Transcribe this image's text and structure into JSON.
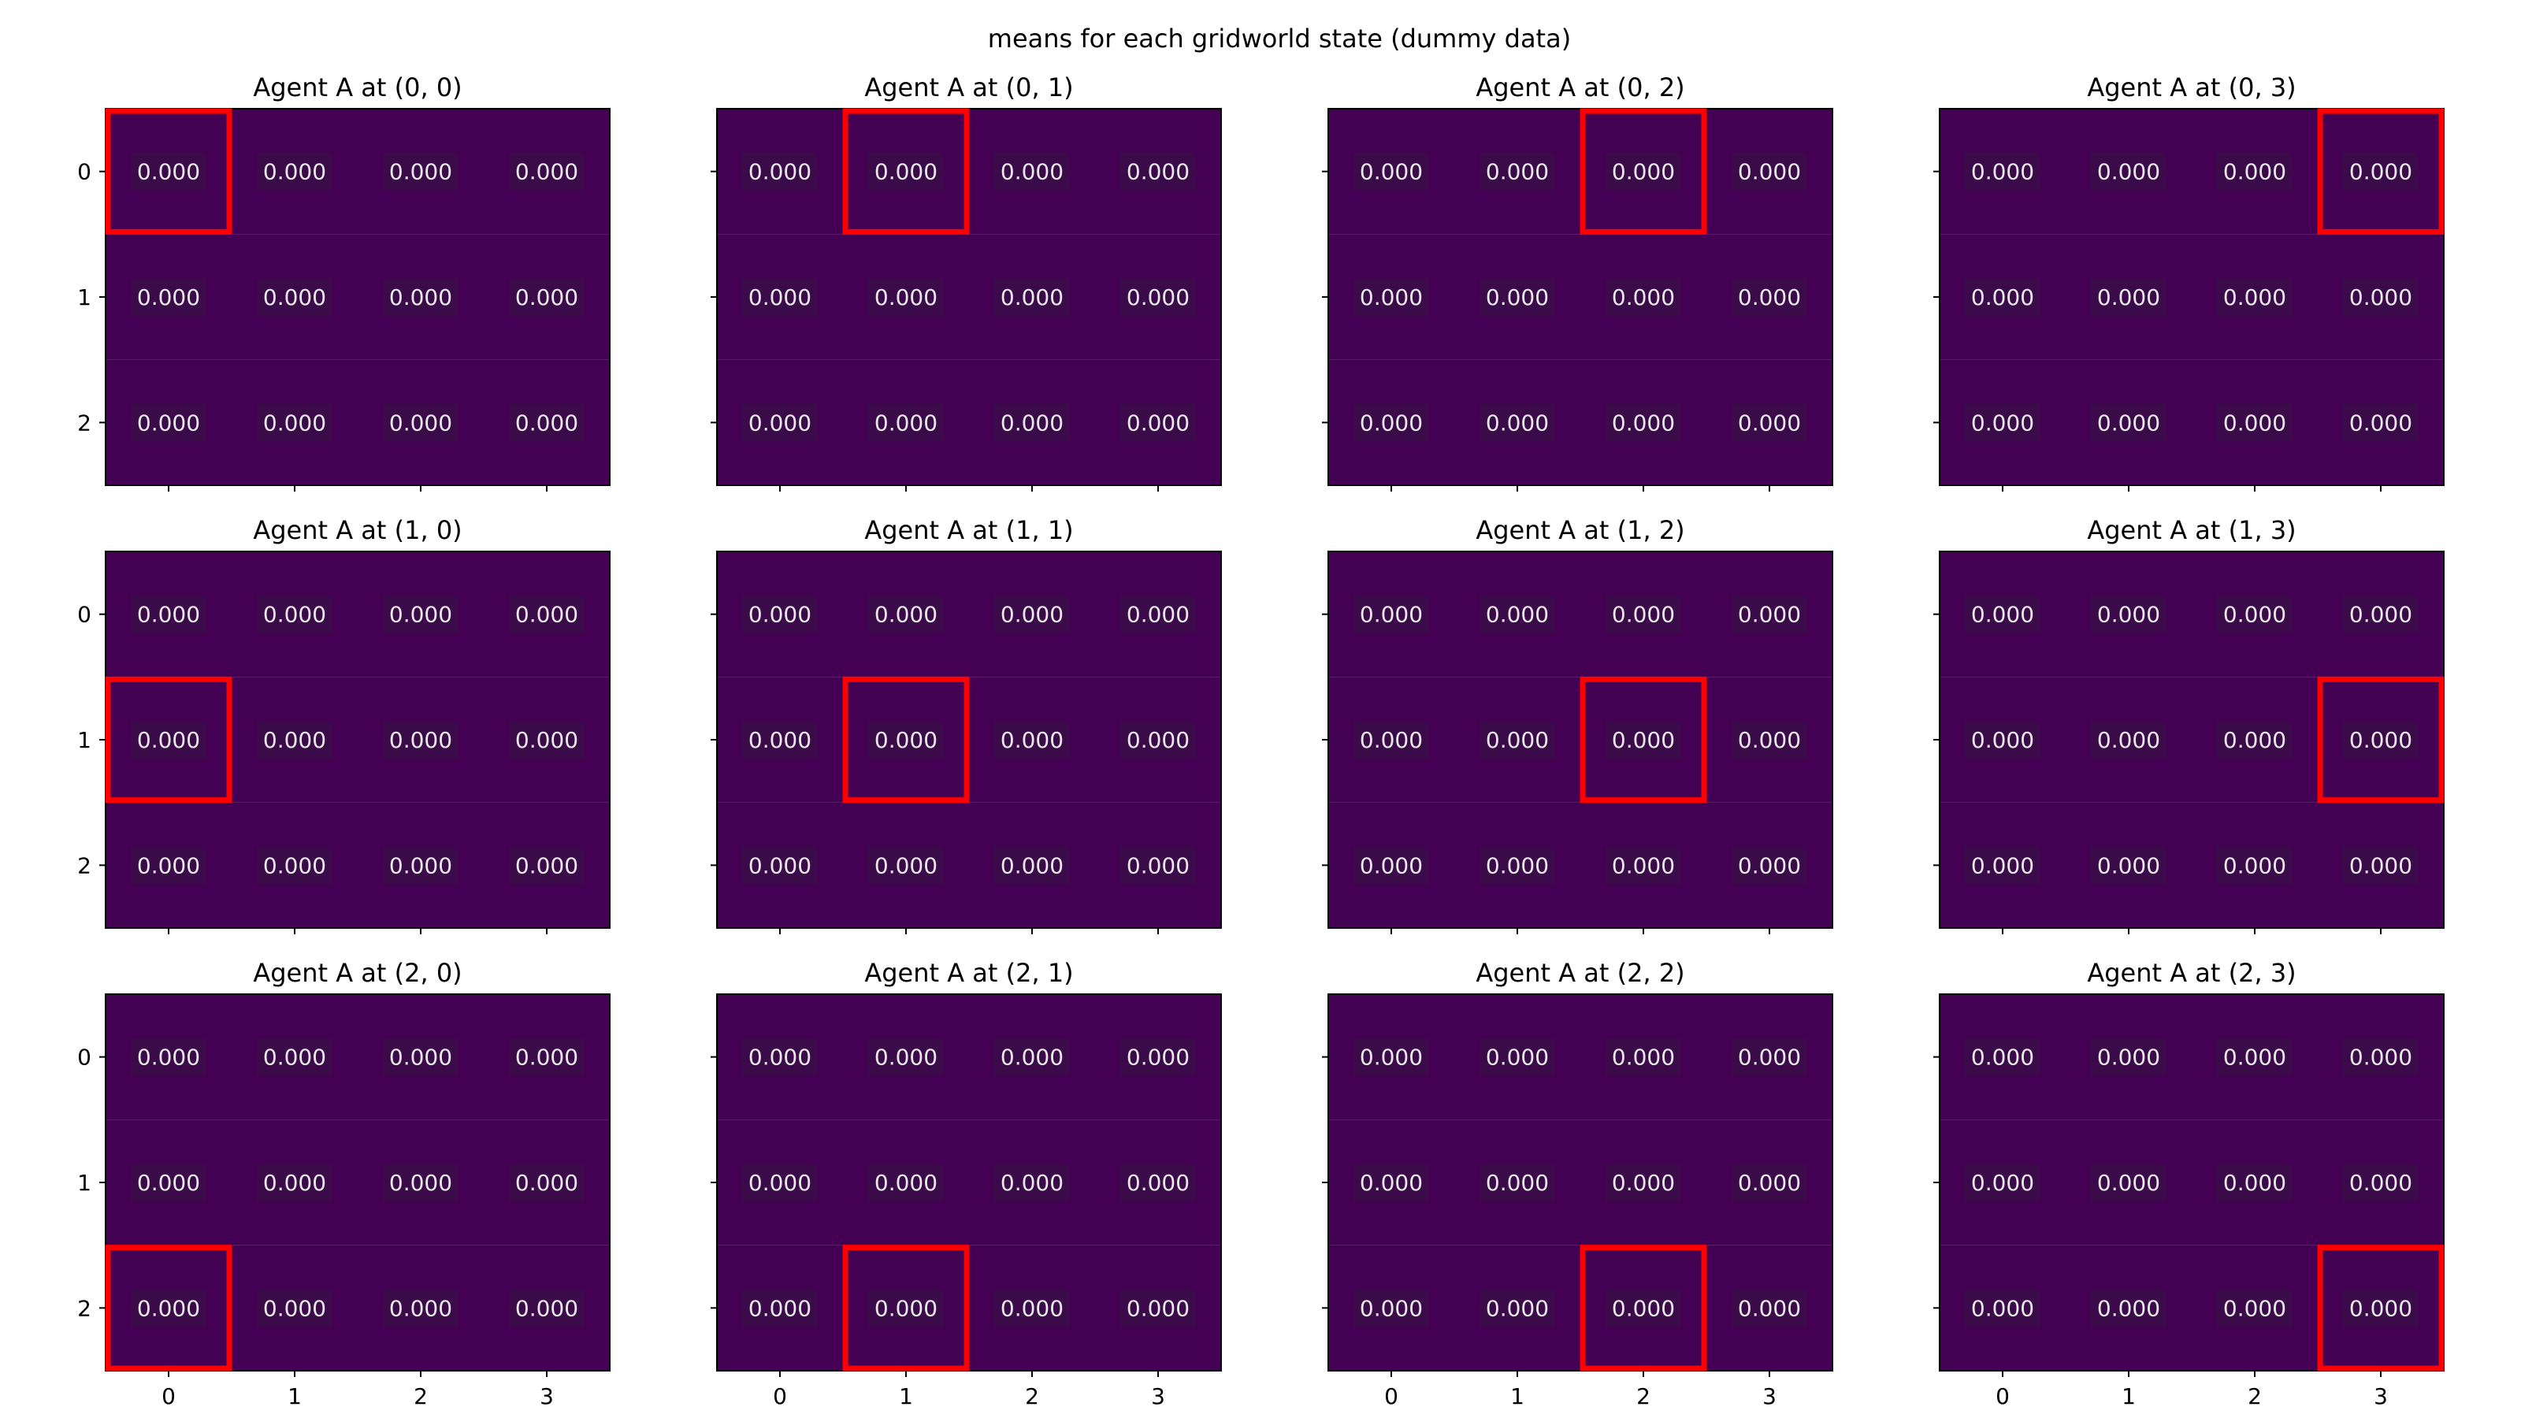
{
  "figure": {
    "suptitle": "means for each gridworld state (dummy data)"
  },
  "colors": {
    "cell": "#440154",
    "cell_label_box": "#3a0a49",
    "cell_text": "#e8e8e8",
    "highlight": "#ff0000",
    "axis": "#000000",
    "text": "#000000"
  },
  "chart_data": {
    "type": "heatmap",
    "grid_rows": 3,
    "grid_cols": 4,
    "x_ticks": [
      "0",
      "1",
      "2",
      "3"
    ],
    "y_ticks": [
      "0",
      "1",
      "2"
    ],
    "value_format": "0.000",
    "panels": [
      {
        "title": "Agent A at (0, 0)",
        "agent": [
          0,
          0
        ],
        "values": [
          [
            0,
            0,
            0,
            0
          ],
          [
            0,
            0,
            0,
            0
          ],
          [
            0,
            0,
            0,
            0
          ]
        ]
      },
      {
        "title": "Agent A at (0, 1)",
        "agent": [
          0,
          1
        ],
        "values": [
          [
            0,
            0,
            0,
            0
          ],
          [
            0,
            0,
            0,
            0
          ],
          [
            0,
            0,
            0,
            0
          ]
        ]
      },
      {
        "title": "Agent A at (0, 2)",
        "agent": [
          0,
          2
        ],
        "values": [
          [
            0,
            0,
            0,
            0
          ],
          [
            0,
            0,
            0,
            0
          ],
          [
            0,
            0,
            0,
            0
          ]
        ]
      },
      {
        "title": "Agent A at (0, 3)",
        "agent": [
          0,
          3
        ],
        "values": [
          [
            0,
            0,
            0,
            0
          ],
          [
            0,
            0,
            0,
            0
          ],
          [
            0,
            0,
            0,
            0
          ]
        ]
      },
      {
        "title": "Agent A at (1, 0)",
        "agent": [
          1,
          0
        ],
        "values": [
          [
            0,
            0,
            0,
            0
          ],
          [
            0,
            0,
            0,
            0
          ],
          [
            0,
            0,
            0,
            0
          ]
        ]
      },
      {
        "title": "Agent A at (1, 1)",
        "agent": [
          1,
          1
        ],
        "values": [
          [
            0,
            0,
            0,
            0
          ],
          [
            0,
            0,
            0,
            0
          ],
          [
            0,
            0,
            0,
            0
          ]
        ]
      },
      {
        "title": "Agent A at (1, 2)",
        "agent": [
          1,
          2
        ],
        "values": [
          [
            0,
            0,
            0,
            0
          ],
          [
            0,
            0,
            0,
            0
          ],
          [
            0,
            0,
            0,
            0
          ]
        ]
      },
      {
        "title": "Agent A at (1, 3)",
        "agent": [
          1,
          3
        ],
        "values": [
          [
            0,
            0,
            0,
            0
          ],
          [
            0,
            0,
            0,
            0
          ],
          [
            0,
            0,
            0,
            0
          ]
        ]
      },
      {
        "title": "Agent A at (2, 0)",
        "agent": [
          2,
          0
        ],
        "values": [
          [
            0,
            0,
            0,
            0
          ],
          [
            0,
            0,
            0,
            0
          ],
          [
            0,
            0,
            0,
            0
          ]
        ]
      },
      {
        "title": "Agent A at (2, 1)",
        "agent": [
          2,
          1
        ],
        "values": [
          [
            0,
            0,
            0,
            0
          ],
          [
            0,
            0,
            0,
            0
          ],
          [
            0,
            0,
            0,
            0
          ]
        ]
      },
      {
        "title": "Agent A at (2, 2)",
        "agent": [
          2,
          2
        ],
        "values": [
          [
            0,
            0,
            0,
            0
          ],
          [
            0,
            0,
            0,
            0
          ],
          [
            0,
            0,
            0,
            0
          ]
        ]
      },
      {
        "title": "Agent A at (2, 3)",
        "agent": [
          2,
          3
        ],
        "values": [
          [
            0,
            0,
            0,
            0
          ],
          [
            0,
            0,
            0,
            0
          ],
          [
            0,
            0,
            0,
            0
          ]
        ]
      }
    ]
  }
}
